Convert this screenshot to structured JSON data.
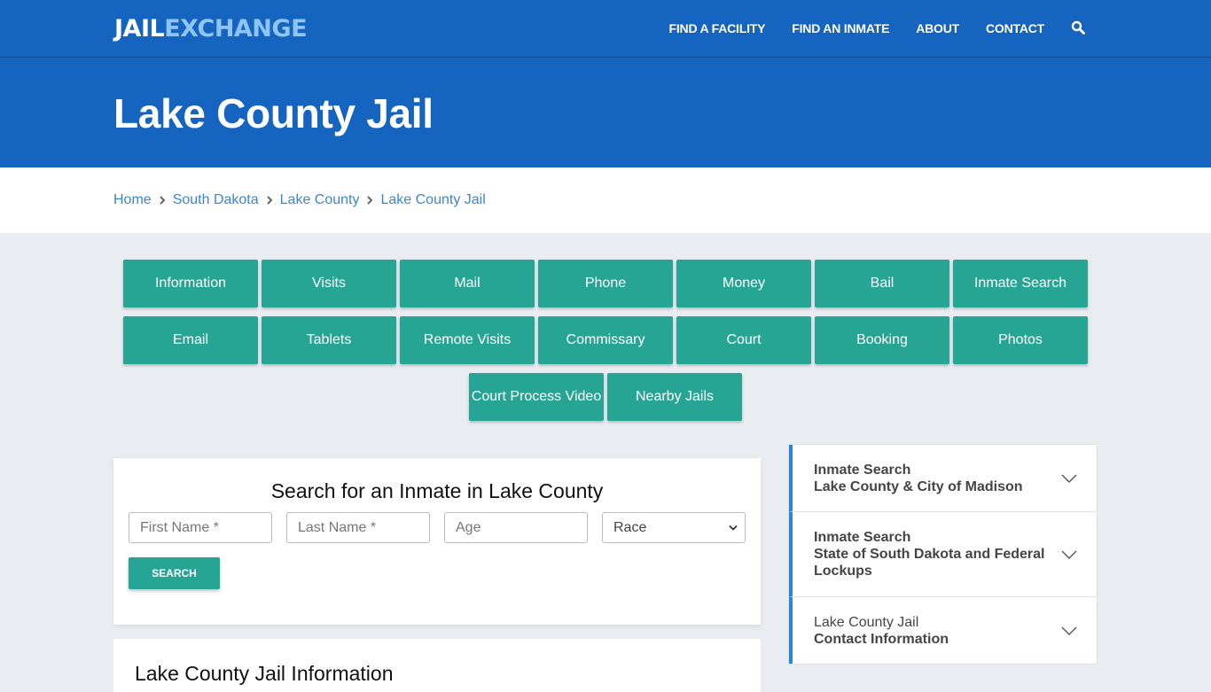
{
  "header": {
    "logo": {
      "part1": "JAIL",
      "part2": "EXCHANGE"
    },
    "nav": [
      {
        "label": "FIND A FACILITY"
      },
      {
        "label": "FIND AN INMATE"
      },
      {
        "label": "ABOUT"
      },
      {
        "label": "CONTACT"
      }
    ],
    "search_icon": "search-icon"
  },
  "hero": {
    "title": "Lake County Jail"
  },
  "breadcrumb": [
    {
      "label": "Home"
    },
    {
      "label": "South Dakota"
    },
    {
      "label": "Lake County"
    },
    {
      "label": "Lake County Jail"
    }
  ],
  "topic_buttons": {
    "row1": [
      "Information",
      "Visits",
      "Mail",
      "Phone",
      "Money",
      "Bail",
      "Inmate Search"
    ],
    "row2": [
      "Email",
      "Tablets",
      "Remote Visits",
      "Commissary",
      "Court",
      "Booking",
      "Photos"
    ],
    "row3": [
      "Court Process Video",
      "Nearby Jails"
    ]
  },
  "search_form": {
    "title": "Search for an Inmate in Lake County",
    "first_name_placeholder": "First Name *",
    "last_name_placeholder": "Last Name *",
    "age_placeholder": "Age",
    "race_selected": "Race",
    "submit_label": "SEARCH"
  },
  "info_section": {
    "title": "Lake County Jail Information"
  },
  "sidebar": {
    "accordions": [
      {
        "line1": "Inmate Search",
        "line2": "Lake County & City of Madison"
      },
      {
        "line1": "Inmate Search",
        "line2": "State of South Dakota and Federal Lockups"
      },
      {
        "line1": "Lake County Jail",
        "line2": "Contact Information"
      }
    ]
  },
  "colors": {
    "brand_blue": "#1565c0",
    "logo_accent": "#8ec5f4",
    "teal_button": "#26a595",
    "link_blue": "#3a87d0",
    "accordion_accent": "#2b86d6"
  }
}
